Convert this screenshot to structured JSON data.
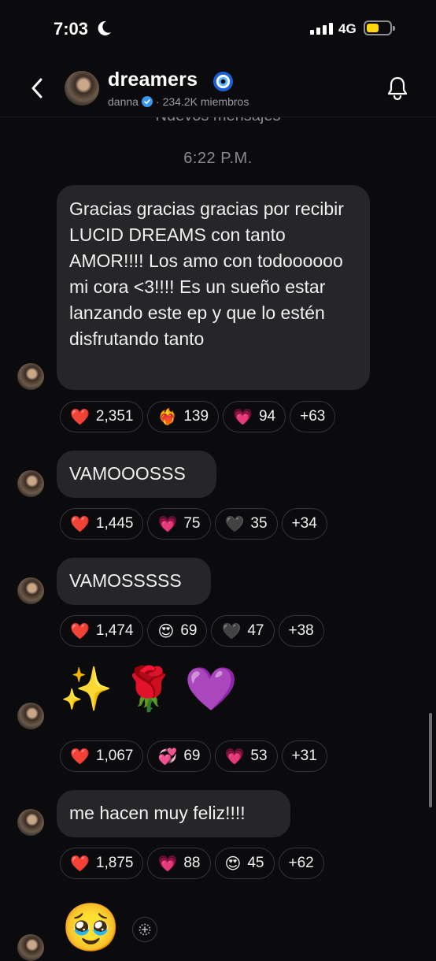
{
  "status_bar": {
    "time": "7:03",
    "network": "4G"
  },
  "header": {
    "channel_name": "dreamers",
    "channel_emoji_icon": "nazar-eye-icon",
    "owner": "danna",
    "members": "234.2K miembros",
    "separator": "·"
  },
  "chat": {
    "new_messages_label": "Nuevos mensajes",
    "timestamp": "6:22 P.M.",
    "messages": [
      {
        "text": "Gracias gracias gracias por recibir LUCID DREAMS con tanto AMOR!!!! Los amo con todoooooo mi cora <3!!!! Es un sueño estar lanzando este ep y que  lo estén disfrutando tanto",
        "reactions": [
          {
            "emoji": "❤️",
            "count": "2,351"
          },
          {
            "emoji": "❤️‍🔥",
            "count": "139"
          },
          {
            "emoji": "💗",
            "count": "94"
          },
          {
            "more": "+63"
          }
        ]
      },
      {
        "text": "VAMOOOSSS",
        "reactions": [
          {
            "emoji": "❤️",
            "count": "1,445"
          },
          {
            "emoji": "💗",
            "count": "75"
          },
          {
            "emoji": "🖤",
            "count": "35"
          },
          {
            "more": "+34"
          }
        ]
      },
      {
        "text": "VAMOSSSSS",
        "reactions": [
          {
            "emoji": "❤️",
            "count": "1,474"
          },
          {
            "emoji": "😍",
            "count": "69"
          },
          {
            "emoji": "🖤",
            "count": "47"
          },
          {
            "more": "+38"
          }
        ]
      },
      {
        "emojis": [
          "✨",
          "🌹",
          "💜"
        ],
        "reactions": [
          {
            "emoji": "❤️",
            "count": "1,067"
          },
          {
            "emoji": "💞",
            "count": "69"
          },
          {
            "emoji": "💗",
            "count": "53"
          },
          {
            "more": "+31"
          }
        ]
      },
      {
        "text": "me hacen muy feliz!!!!",
        "reactions": [
          {
            "emoji": "❤️",
            "count": "1,875"
          },
          {
            "emoji": "💗",
            "count": "88"
          },
          {
            "emoji": "😍",
            "count": "45"
          },
          {
            "more": "+62"
          }
        ]
      },
      {
        "emojis": [
          "🥹"
        ]
      }
    ]
  },
  "colors": {
    "background": "#0b0b0d",
    "bubble": "#262629",
    "verified": "#3897f0",
    "battery": "#ffd60a"
  }
}
